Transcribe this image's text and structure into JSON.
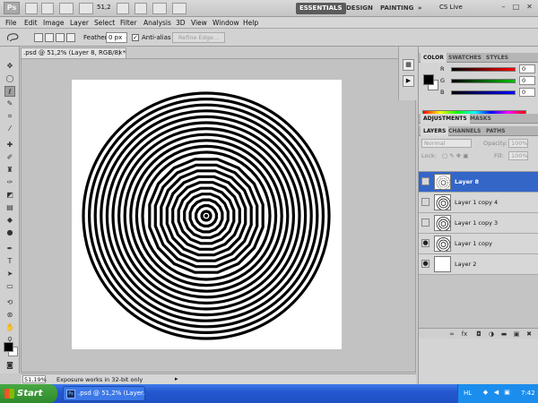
{
  "app": {
    "logo": "Ps",
    "zoom": "51,2"
  },
  "workspaces": {
    "essentials": "ESSENTIALS",
    "design": "DESIGN",
    "painting": "PAINTING",
    "more": "»"
  },
  "cs_live": "CS Live",
  "window_controls": {
    "minimize": "–",
    "maximize": "□",
    "close": "✕"
  },
  "menu": [
    "File",
    "Edit",
    "Image",
    "Layer",
    "Select",
    "Filter",
    "Analysis",
    "3D",
    "View",
    "Window",
    "Help"
  ],
  "options": {
    "feather_label": "Feather:",
    "feather_value": "0 px",
    "anti_alias_label": "Anti-alias",
    "anti_alias_checked": "✓",
    "refine_edge": "Refine Edge..."
  },
  "document": {
    "tab_title": ".psd @ 51,2% (Layer 8, RGB/8) *",
    "close_glyph": "×",
    "zoom_status": "51,19%",
    "status_message": "Exposure works in 32-bit only",
    "status_arrow": "▸"
  },
  "color_panel": {
    "tabs": [
      "COLOR",
      "SWATCHES",
      "STYLES"
    ],
    "channels": [
      {
        "label": "R",
        "value": "0",
        "gradient": "#ff0000"
      },
      {
        "label": "G",
        "value": "0",
        "gradient": "#00c000"
      },
      {
        "label": "B",
        "value": "0",
        "gradient": "#0000ff"
      }
    ]
  },
  "adjust_tabs": [
    "ADJUSTMENTS",
    "MASKS"
  ],
  "layers_panel": {
    "tabs": [
      "LAYERS",
      "CHANNELS",
      "PATHS"
    ],
    "blend_mode": "Normal",
    "opacity_label": "Opacity:",
    "opacity_value": "100%",
    "lock_label": "Lock:",
    "fill_label": "Fill:",
    "fill_value": "100%",
    "layers": [
      {
        "name": "Layer 8",
        "selected": true,
        "visible": false
      },
      {
        "name": "Layer 1 copy 4",
        "selected": false,
        "visible": false
      },
      {
        "name": "Layer 1 copy 3",
        "selected": false,
        "visible": false
      },
      {
        "name": "Layer 1 copy",
        "selected": false,
        "visible": true
      },
      {
        "name": "Layer 2",
        "selected": false,
        "visible": true
      }
    ],
    "footer_icons": [
      "link-icon",
      "fx-icon",
      "mask-icon",
      "adjustment-icon",
      "group-icon",
      "new-layer-icon",
      "trash-icon"
    ]
  },
  "taskbar": {
    "start_label": "Start",
    "task_label": ".psd @ 51,2% (Layer...",
    "task_icon": "Ps",
    "language": "HL",
    "time": "7:42"
  },
  "colors": {
    "selection": "#3466c8",
    "taskbar": "#2458d0",
    "start": "#3a9a36"
  }
}
